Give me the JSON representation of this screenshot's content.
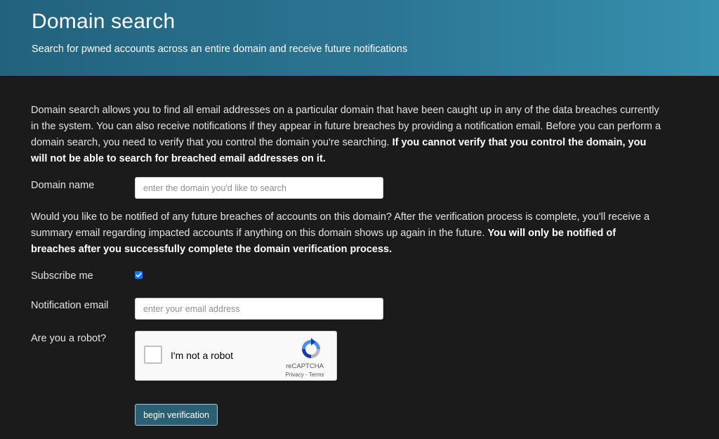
{
  "header": {
    "title": "Domain search",
    "subtitle": "Search for pwned accounts across an entire domain and receive future notifications"
  },
  "intro": {
    "text": "Domain search allows you to find all email addresses on a particular domain that have been caught up in any of the data breaches currently in the system. You can also receive notifications if they appear in future breaches by providing a notification email. Before you can perform a domain search, you need to verify that you control the domain you're searching. ",
    "bold": "If you cannot verify that you control the domain, you will not be able to search for breached email addresses on it."
  },
  "domain": {
    "label": "Domain name",
    "placeholder": "enter the domain you'd like to search",
    "value": ""
  },
  "notify": {
    "text": "Would you like to be notified of any future breaches of accounts on this domain? After the verification process is complete, you'll receive a summary email regarding impacted accounts if anything on this domain shows up again in the future. ",
    "bold": "You will only be notified of breaches after you successfully complete the domain verification process."
  },
  "subscribe": {
    "label": "Subscribe me",
    "checked": true
  },
  "email": {
    "label": "Notification email",
    "placeholder": "enter your email address",
    "value": ""
  },
  "robot": {
    "label": "Are you a robot?",
    "checkbox_text": "I'm not a robot",
    "brand": "reCAPTCHA",
    "privacy": "Privacy",
    "separator": " - ",
    "terms": "Terms"
  },
  "submit": {
    "label": "begin verification"
  },
  "colors": {
    "header_start": "#22627e",
    "header_end": "#3791af",
    "background": "#1b1b1b",
    "button": "#2b5f73",
    "checkbox": "#1a73e8"
  },
  "icons": {
    "checkmark": "check-icon",
    "recaptcha_logo": "recaptcha-logo-icon"
  }
}
